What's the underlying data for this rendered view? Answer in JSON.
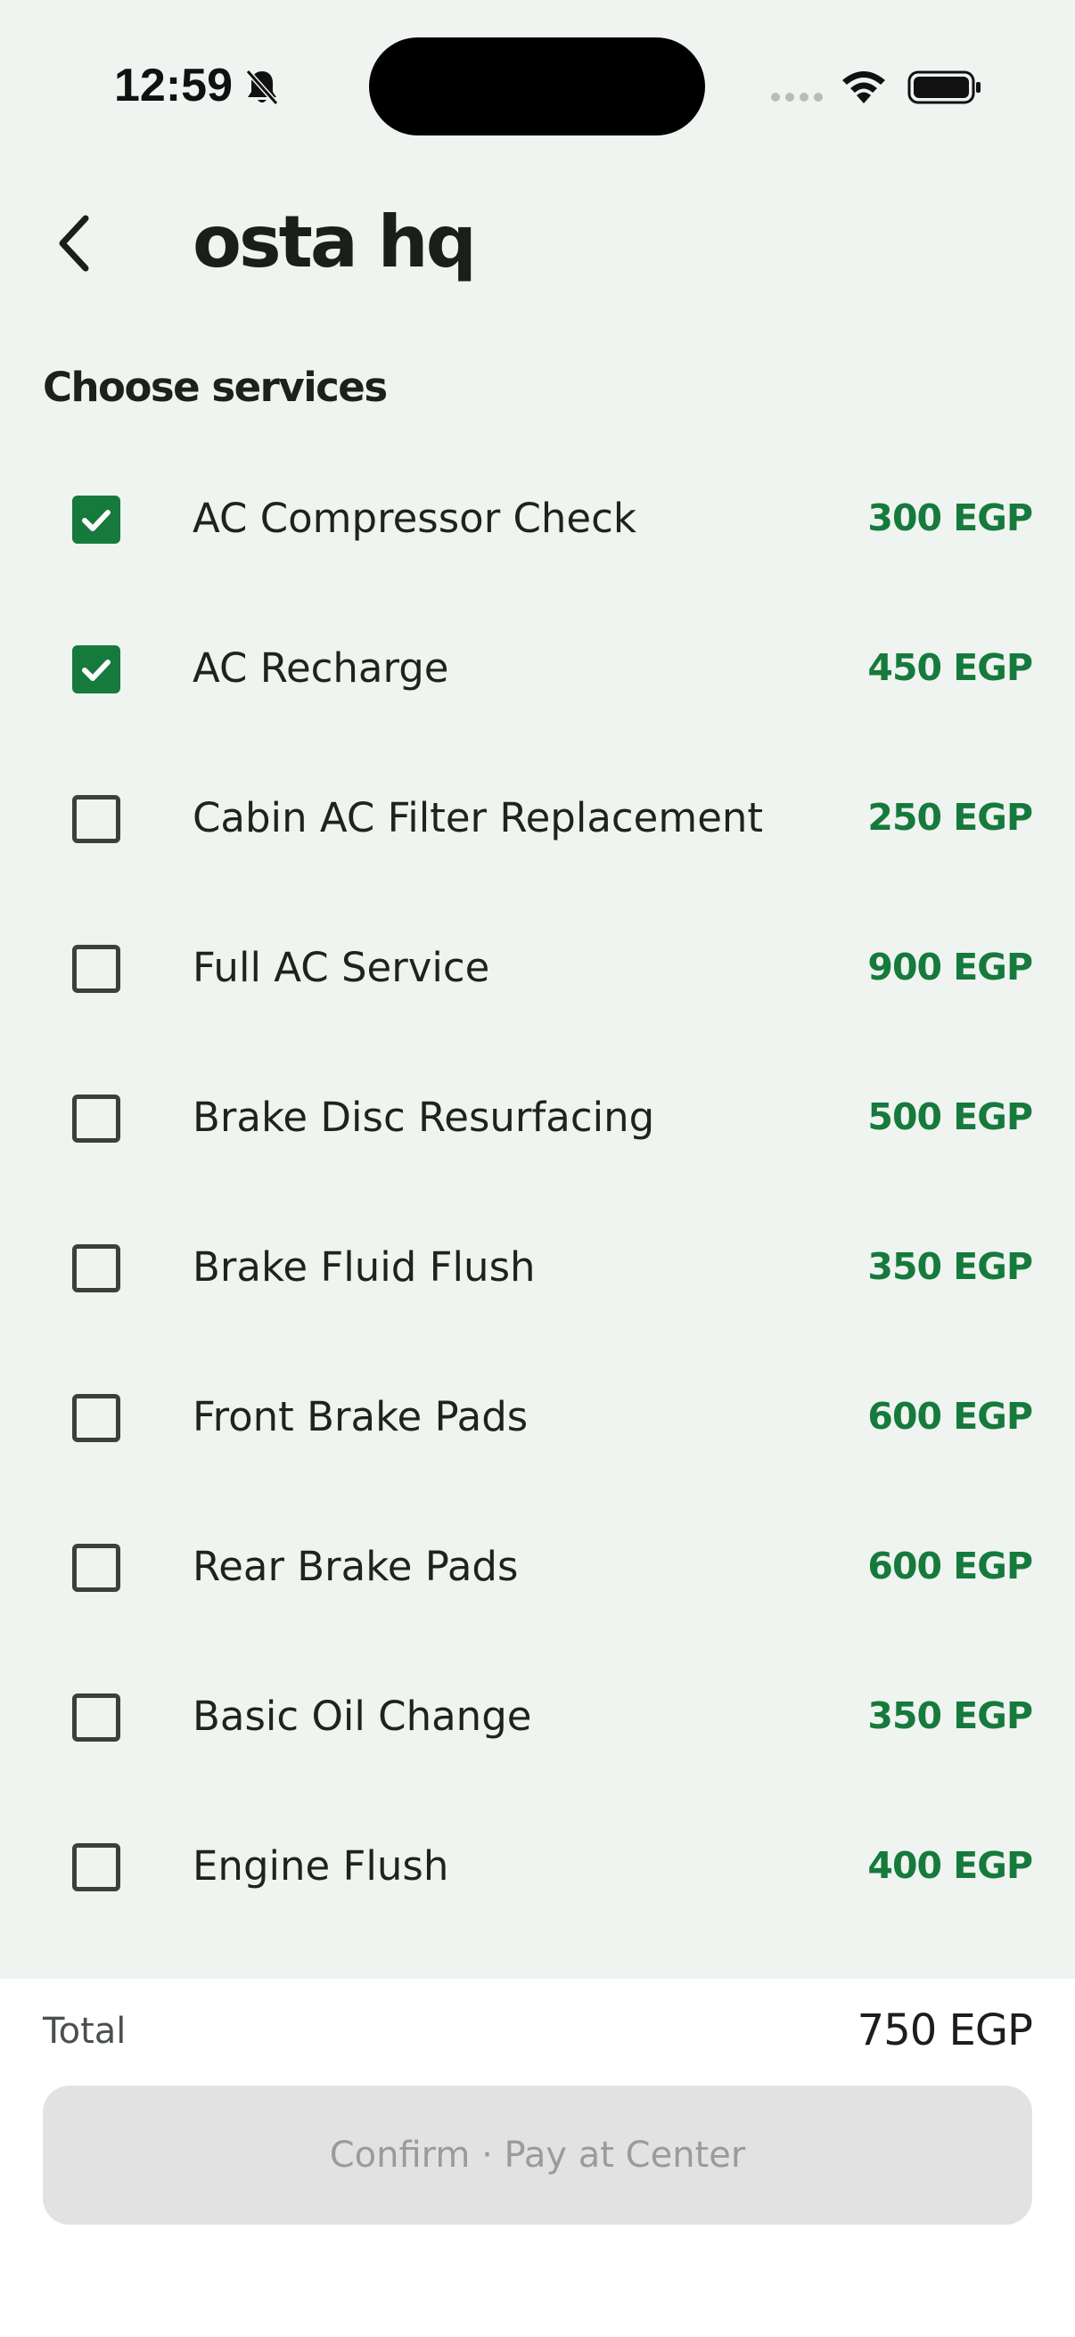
{
  "status_bar": {
    "time": "12:59",
    "icons": [
      "bell-slash-icon",
      "signal-icon",
      "wifi-icon",
      "battery-icon"
    ]
  },
  "header": {
    "title": "osta hq",
    "back_icon": "chevron-left-icon"
  },
  "section_title": "Choose services",
  "colors": {
    "accent": "#167a3d",
    "background": "#eff4f0",
    "button_disabled": "#e2e2e2"
  },
  "services": [
    {
      "name": "AC Compressor Check",
      "price": "300 EGP",
      "checked": true
    },
    {
      "name": "AC Recharge",
      "price": "450 EGP",
      "checked": true
    },
    {
      "name": "Cabin AC Filter Replacement",
      "price": "250 EGP",
      "checked": false
    },
    {
      "name": "Full AC Service",
      "price": "900 EGP",
      "checked": false
    },
    {
      "name": "Brake Disc Resurfacing",
      "price": "500 EGP",
      "checked": false
    },
    {
      "name": "Brake Fluid Flush",
      "price": "350 EGP",
      "checked": false
    },
    {
      "name": "Front Brake Pads",
      "price": "600 EGP",
      "checked": false
    },
    {
      "name": "Rear Brake Pads",
      "price": "600 EGP",
      "checked": false
    },
    {
      "name": "Basic Oil Change",
      "price": "350 EGP",
      "checked": false
    },
    {
      "name": "Engine Flush",
      "price": "400 EGP",
      "checked": false
    }
  ],
  "footer": {
    "total_label": "Total",
    "total_value": "750 EGP",
    "confirm_label": "Confirm · Pay at Center"
  }
}
